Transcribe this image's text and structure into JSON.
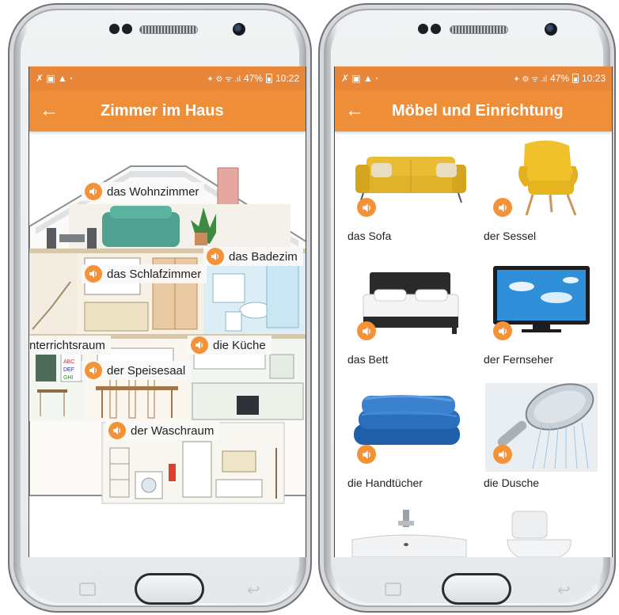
{
  "colors": {
    "statusbar": "#e8863a",
    "appbar": "#ef8e38",
    "speaker_button": "#f39237",
    "text": "#222222"
  },
  "left_phone": {
    "status": {
      "left_icons": "✗ ▣ ▲ ·",
      "right_icons": "✦ ⚙ ᯤ .ıl",
      "battery": "47%",
      "time": "10:22"
    },
    "appbar": {
      "back_icon": "←",
      "title": "Zimmer im Haus"
    },
    "room_labels": [
      {
        "text": "das Wohnzimmer",
        "icon": "speaker-icon"
      },
      {
        "text": "das Badezim",
        "icon": "speaker-icon"
      },
      {
        "text": "das Schlafzimmer",
        "icon": "speaker-icon"
      },
      {
        "text": "nterrichtsraum",
        "icon": "none"
      },
      {
        "text": "die Küche",
        "icon": "speaker-icon"
      },
      {
        "text": "der Speisesaal",
        "icon": "speaker-icon"
      },
      {
        "text": "der Waschraum",
        "icon": "speaker-icon"
      }
    ],
    "nav": {
      "recent_icon": "recent-apps-icon",
      "home_icon": "home-button",
      "back_icon": "↩"
    }
  },
  "right_phone": {
    "status": {
      "left_icons": "✗ ▣ ▲ ·",
      "right_icons": "✦ ⚙ ᯤ .ıl",
      "battery": "47%",
      "time": "10:23"
    },
    "appbar": {
      "back_icon": "←",
      "title": "Möbel und Einrichtung"
    },
    "items": [
      {
        "label": "das Sofa",
        "icon": "sofa-image"
      },
      {
        "label": "der Sessel",
        "icon": "armchair-image"
      },
      {
        "label": "das Bett",
        "icon": "bed-image"
      },
      {
        "label": "der Fernseher",
        "icon": "tv-image"
      },
      {
        "label": "die Handtücher",
        "icon": "towels-image"
      },
      {
        "label": "die Dusche",
        "icon": "shower-image"
      },
      {
        "label": "",
        "icon": "sink-image"
      },
      {
        "label": "",
        "icon": "toilet-image"
      }
    ],
    "nav": {
      "recent_icon": "recent-apps-icon",
      "home_icon": "home-button",
      "back_icon": "↩"
    }
  }
}
